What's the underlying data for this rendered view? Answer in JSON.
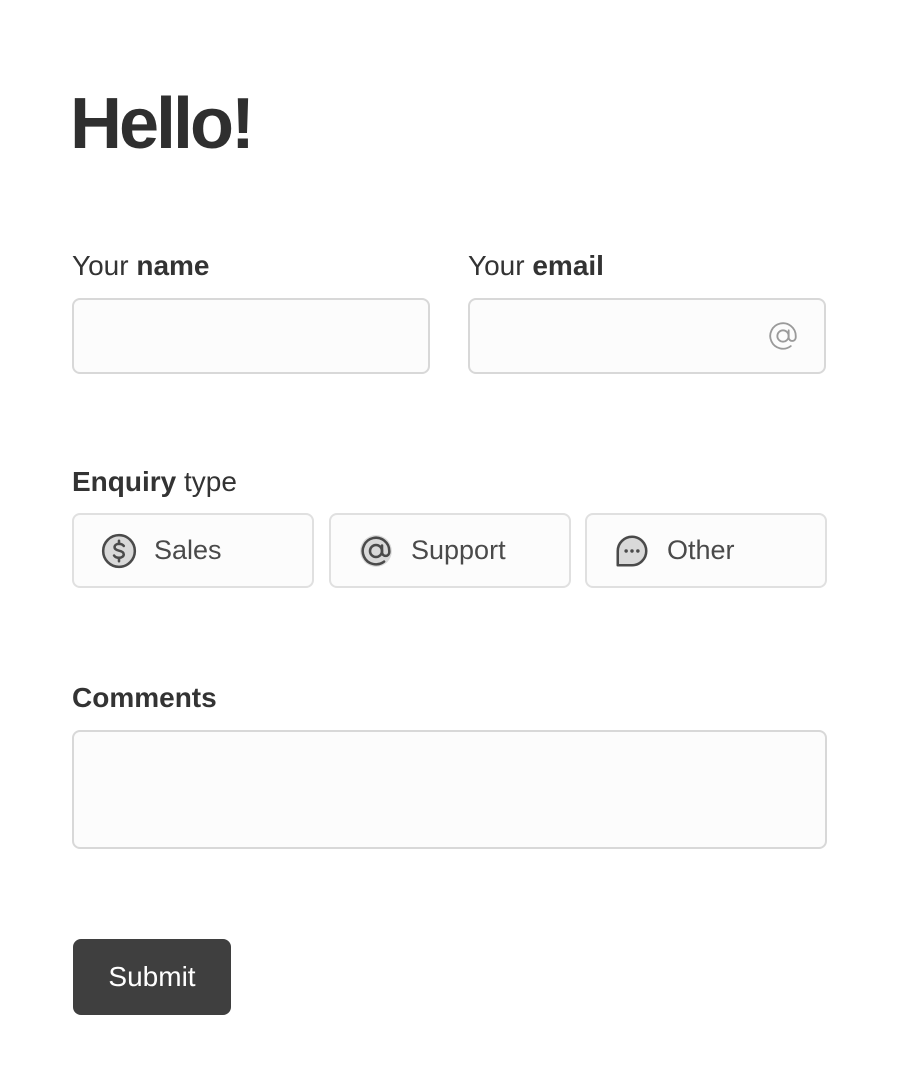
{
  "header": {
    "title": "Hello!"
  },
  "form": {
    "name": {
      "label_prefix": "Your",
      "label_bold": "name",
      "value": "",
      "placeholder": ""
    },
    "email": {
      "label_prefix": "Your",
      "label_bold": "email",
      "value": "",
      "placeholder": "",
      "icon": "at-sign-icon"
    },
    "enquiry": {
      "label_bold": "Enquiry",
      "label_suffix": "type",
      "options": [
        {
          "label": "Sales",
          "icon": "dollar-circle-icon"
        },
        {
          "label": "Support",
          "icon": "at-sign-circle-icon"
        },
        {
          "label": "Other",
          "icon": "chat-bubble-dots-icon"
        }
      ],
      "selected": null
    },
    "comments": {
      "label": "Comments",
      "value": "",
      "placeholder": ""
    },
    "submit_label": "Submit"
  },
  "colors": {
    "text": "#333333",
    "field_bg": "#fcfcfc",
    "field_border": "#d8d8d8",
    "button_bg": "#3f3f3f",
    "button_text": "#ffffff",
    "icon_fill": "#d9d9d9",
    "icon_stroke": "#4a4a4a"
  }
}
